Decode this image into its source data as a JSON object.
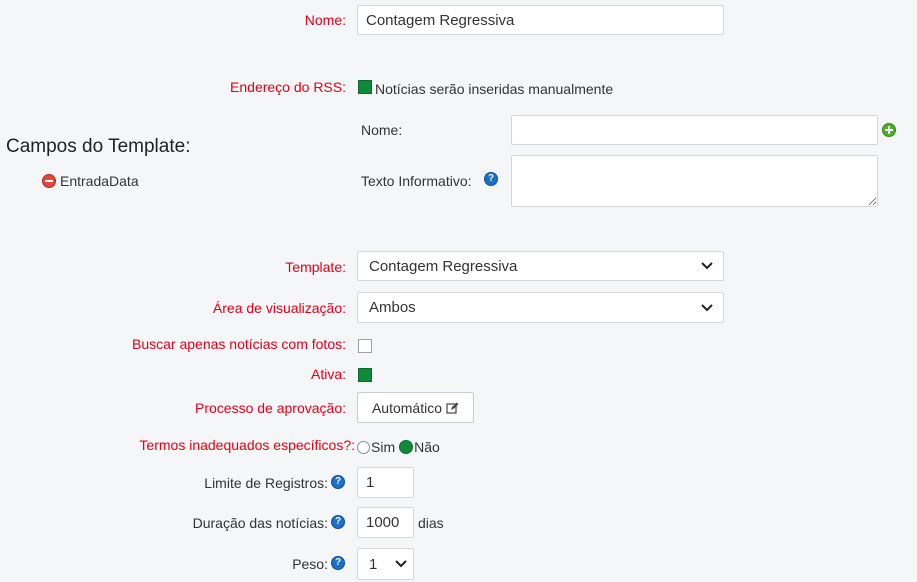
{
  "nome": {
    "label": "Nome:",
    "value": "Contagem Regressiva"
  },
  "rss": {
    "label": "Endereço do RSS:",
    "checkbox_label": "Notícias serão inseridas manualmente",
    "checked": true
  },
  "campos": {
    "heading": "Campos do Template:",
    "items": [
      {
        "label": "EntradaData"
      }
    ],
    "nome_label": "Nome:",
    "nome_value": "",
    "texto_label": "Texto Informativo:",
    "texto_value": ""
  },
  "template": {
    "label": "Template:",
    "value": "Contagem Regressiva"
  },
  "area": {
    "label": "Área de visualização:",
    "value": "Ambos"
  },
  "buscar": {
    "label": "Buscar apenas notícias com fotos:",
    "checked": false
  },
  "ativa": {
    "label": "Ativa:",
    "checked": true
  },
  "aprovacao": {
    "label": "Processo de aprovação:",
    "button_label": "Automático"
  },
  "termos": {
    "label": "Termos inadequados específicos?:",
    "options": [
      "Sim",
      "Não"
    ],
    "selected": "Não"
  },
  "limite": {
    "label": "Limite de Registros:",
    "value": "1"
  },
  "duracao": {
    "label": "Duração das notícias:",
    "value": "1000",
    "unit": "dias"
  },
  "peso": {
    "label": "Peso:",
    "value": "1"
  },
  "colors": {
    "required_label": "#e0001a",
    "accent_green": "#0f8a3a",
    "help_blue": "#1a6fc9"
  }
}
